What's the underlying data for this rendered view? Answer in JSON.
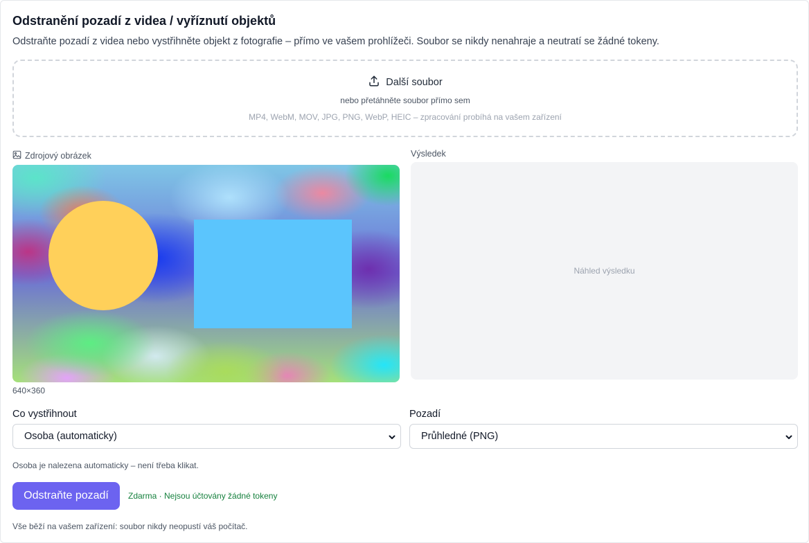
{
  "header": {
    "title": "Odstranění pozadí z videa / vyříznutí objektů",
    "subtitle": "Odstraňte pozadí z videa nebo vystřihněte objekt z fotografie – přímo ve vašem prohlížeči. Soubor se nikdy nenahraje a neutratí se žádné tokeny."
  },
  "dropzone": {
    "upload_label": "Další soubor",
    "upload_icon": "upload-icon",
    "hint": "nebo přetáhněte soubor přímo sem",
    "formats": "MP4, WebM, MOV, JPG, PNG, WebP, HEIC – zpracování probíhá na vašem zařízení"
  },
  "source": {
    "label": "Zdrojový obrázek",
    "icon": "image-icon",
    "dimensions": "640×360",
    "shape_colors": {
      "circle": "#ffd05a",
      "rectangle": "#5bc5fd"
    }
  },
  "result": {
    "label": "Výsledek",
    "placeholder": "Náhled výsledku"
  },
  "controls": {
    "cut_label": "Co vystřihnout",
    "cut_value": "Osoba (automaticky)",
    "background_label": "Pozadí",
    "background_value": "Průhledné (PNG)",
    "hint": "Osoba je nalezena automaticky – není třeba klikat."
  },
  "action": {
    "button_label": "Odstraňte pozadí",
    "free_note": "Zdarma · Nejsou účtovány žádné tokeny",
    "footer_note": "Vše běží na vašem zařízení: soubor nikdy neopustí váš počítač."
  },
  "colors": {
    "accent": "#6c63f0",
    "free_text": "#15803d",
    "result_bg": "#f3f4f6"
  }
}
